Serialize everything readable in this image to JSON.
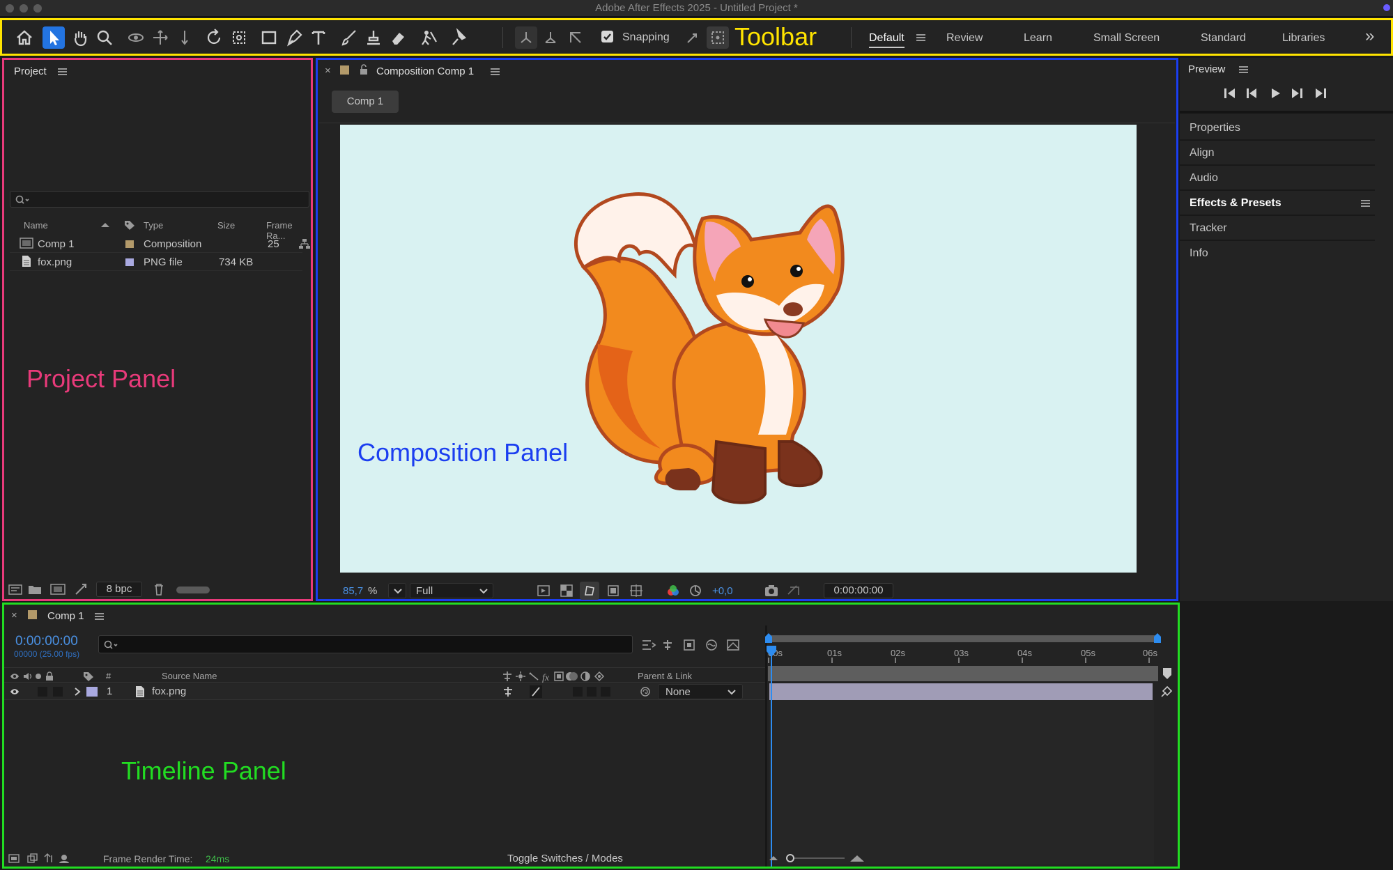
{
  "window": {
    "title": "Adobe After Effects 2025 - Untitled Project *"
  },
  "toolbar": {
    "snapping_label": "Snapping",
    "annotation": "Toolbar",
    "workspaces": [
      "Default",
      "Review",
      "Learn",
      "Small Screen",
      "Standard",
      "Libraries"
    ],
    "active_workspace": "Default",
    "more_glyph": "»"
  },
  "project": {
    "title": "Project",
    "annotation": "Project Panel",
    "search": {
      "value": "",
      "placeholder": ""
    },
    "columns": [
      "Name",
      "Type",
      "Size",
      "Frame Ra..."
    ],
    "items": [
      {
        "name": "Comp 1",
        "type": "Composition",
        "size": "",
        "frame_rate": "25",
        "label_color": "#b39a6a"
      },
      {
        "name": "fox.png",
        "type": "PNG file",
        "size": "734 KB",
        "frame_rate": "",
        "label_color": "#a9a9e0"
      }
    ],
    "bpc": "8 bpc"
  },
  "composition": {
    "tab_title": "Composition Comp 1",
    "comp_tab": "Comp 1",
    "annotation": "Composition Panel",
    "background": "#d9f2f2",
    "zoom_value": "85,7",
    "zoom_unit": "%",
    "resolution": "Full",
    "exposure": "+0,0",
    "timecode": "0:00:00:00"
  },
  "right_panel": {
    "preview_title": "Preview",
    "items": [
      "Properties",
      "Align",
      "Audio",
      "Effects & Presets",
      "Tracker",
      "Info"
    ]
  },
  "timeline": {
    "tab_title": "Comp 1",
    "annotation": "Timeline Panel",
    "timecode": "0:00:00:00",
    "frame_info": "00000 (25.00 fps)",
    "search": {
      "value": "",
      "placeholder": ""
    },
    "columns": {
      "number": "#",
      "source_name": "Source Name",
      "parent": "Parent & Link"
    },
    "ruler": [
      "00s",
      "01s",
      "02s",
      "03s",
      "04s",
      "05s",
      "06s"
    ],
    "layers": [
      {
        "index": "1",
        "name": "fox.png",
        "parent": "None",
        "label_color": "#a9a9e0"
      }
    ],
    "render_time_label": "Frame Render Time:",
    "render_time_value": "24ms",
    "toggle_label": "Toggle Switches / Modes"
  },
  "colors": {
    "accent": "#2374e1",
    "toolbar_outline": "#ffe400",
    "project_outline": "#e83a7a",
    "comp_outline": "#1b3ef0",
    "timeline_outline": "#22dd22"
  }
}
